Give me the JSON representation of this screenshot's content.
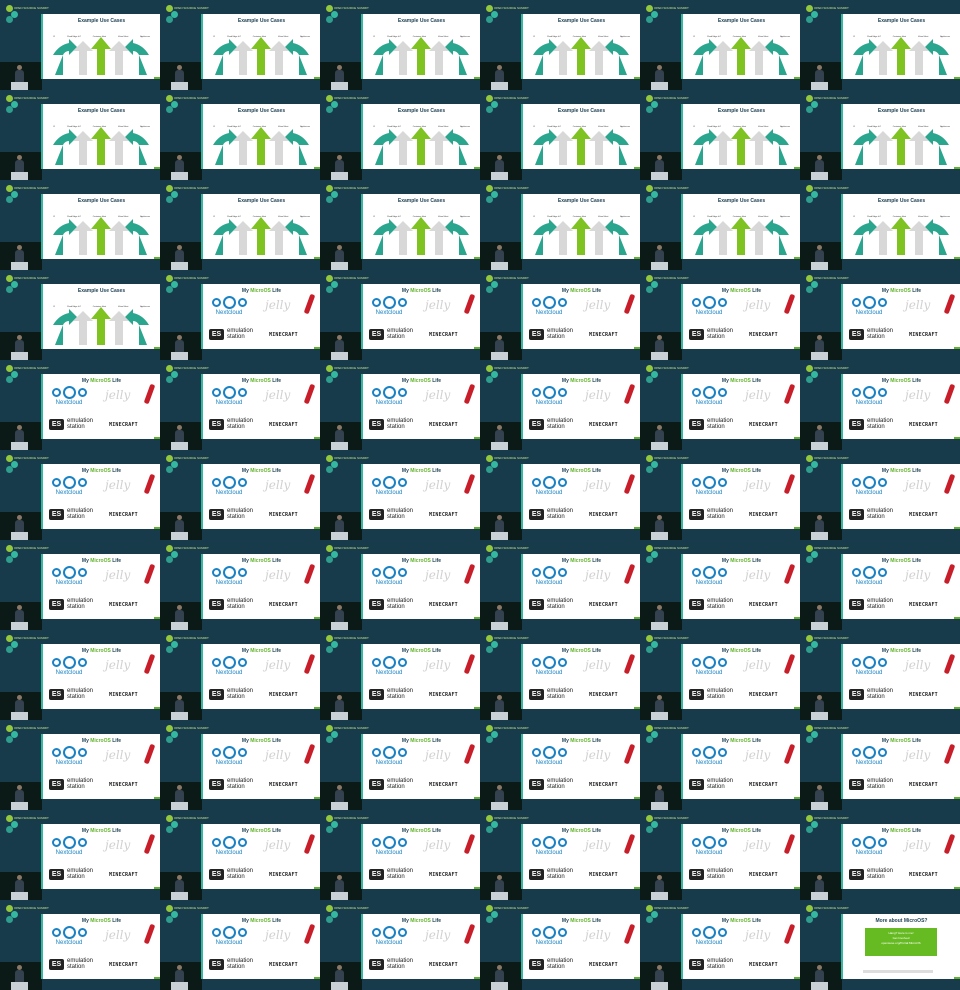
{
  "background_color": "#173b4a",
  "event_logo": {
    "text": "OPEN SOURCE SUMMIT"
  },
  "slides": {
    "use_cases": {
      "title": "Example Use Cases",
      "labels": [
        "CI",
        "Cloud Edge IoT",
        "Container Host",
        "Virtual Host",
        "Appliances"
      ]
    },
    "my_life": {
      "title_prefix": "My ",
      "title_highlight": "MicroOS",
      "title_suffix": " Life",
      "nextcloud": "Nextcloud",
      "jellyfin_text": "jelly",
      "es_badge": "ES",
      "es_line1": "emulation",
      "es_line2": "station",
      "minecraft": "MINECRAFT"
    },
    "more": {
      "title": "More about MicroOS?",
      "line1": "Hang? Here is me!",
      "line2": "Get Involved",
      "line3": "opensuse.org/Portal:MicroOS"
    }
  },
  "frames": [
    "use_cases",
    "use_cases",
    "use_cases",
    "use_cases",
    "use_cases",
    "use_cases",
    "use_cases",
    "use_cases",
    "use_cases",
    "use_cases",
    "use_cases",
    "use_cases",
    "use_cases",
    "use_cases",
    "use_cases",
    "use_cases",
    "use_cases",
    "use_cases",
    "use_cases",
    "my_life",
    "my_life",
    "my_life",
    "my_life",
    "my_life",
    "my_life",
    "my_life",
    "my_life",
    "my_life",
    "my_life",
    "my_life",
    "my_life",
    "my_life",
    "my_life",
    "my_life",
    "my_life",
    "my_life",
    "my_life",
    "my_life",
    "my_life",
    "my_life",
    "my_life",
    "my_life",
    "my_life",
    "my_life",
    "my_life",
    "my_life",
    "my_life",
    "my_life",
    "my_life",
    "my_life",
    "my_life",
    "my_life",
    "my_life",
    "my_life",
    "my_life",
    "my_life",
    "my_life",
    "my_life",
    "my_life",
    "my_life",
    "my_life",
    "my_life",
    "my_life",
    "my_life",
    "my_life",
    "more"
  ]
}
